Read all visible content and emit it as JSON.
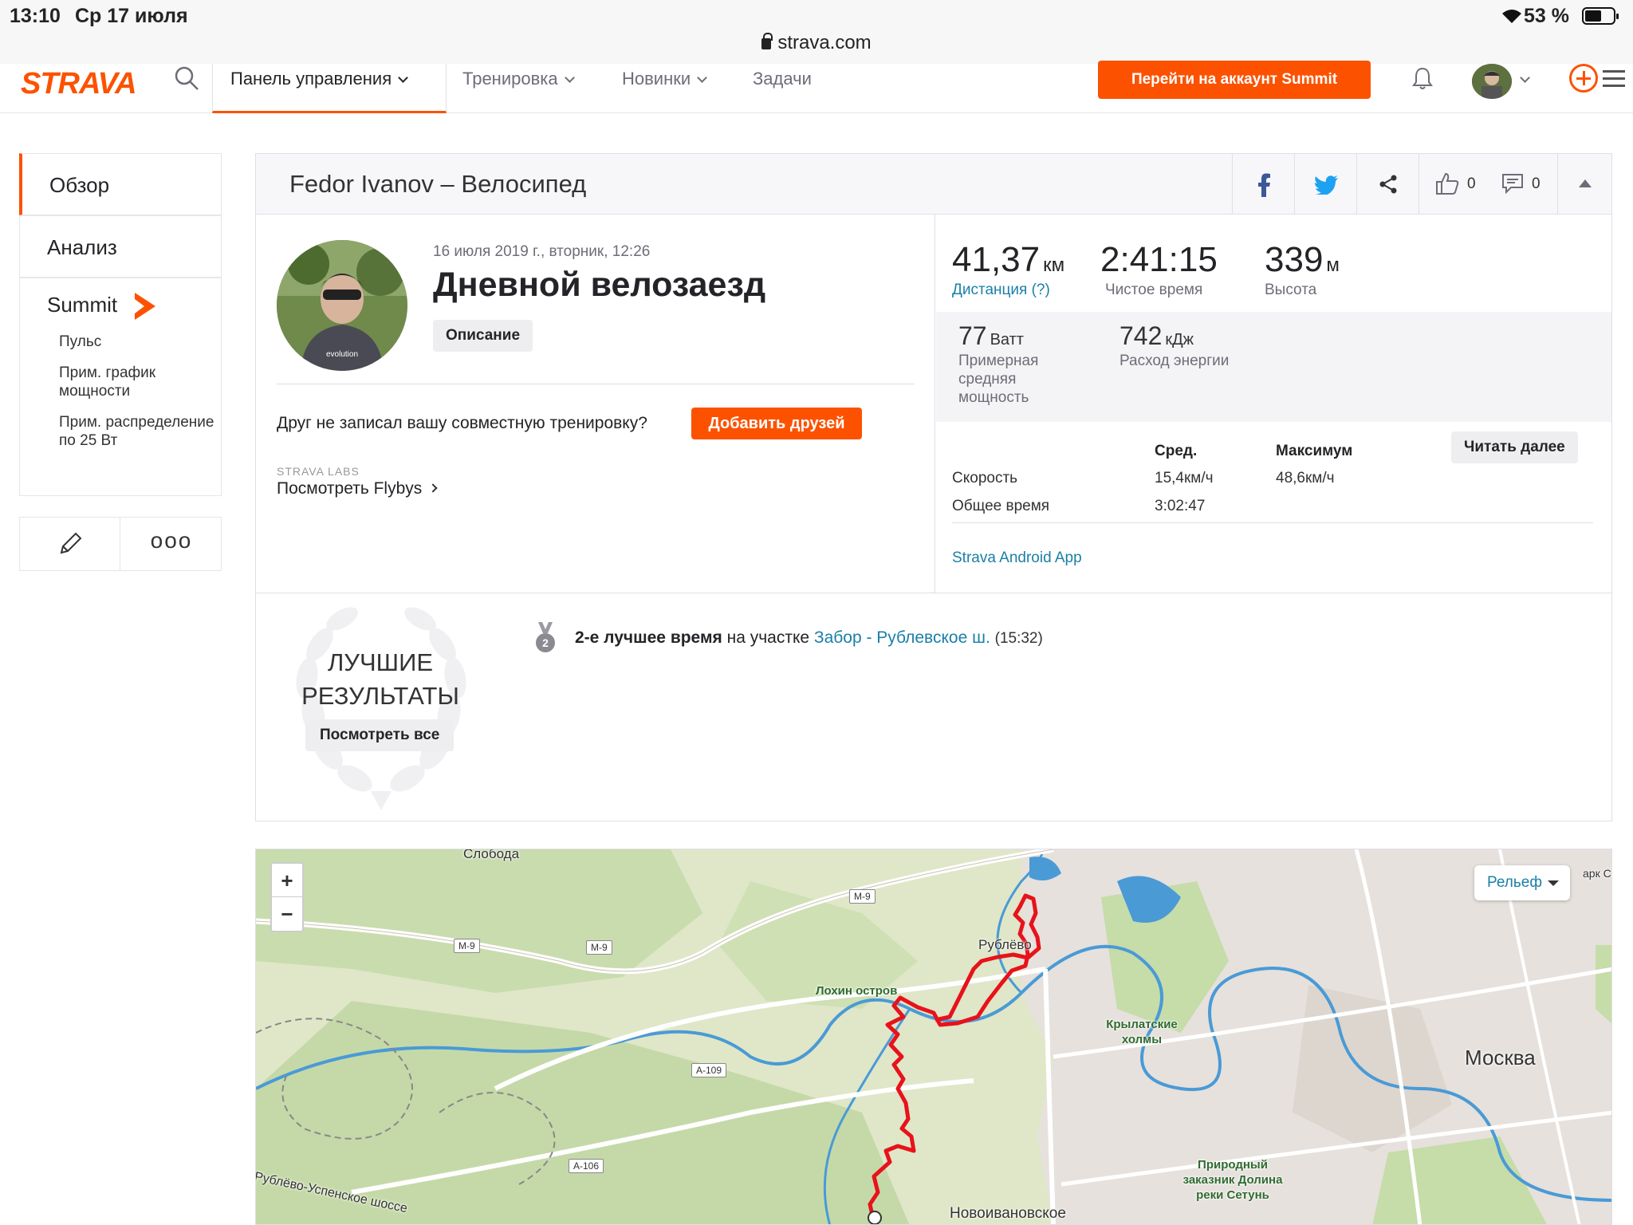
{
  "status_bar": {
    "time": "13:10",
    "date": "Ср 17 июля",
    "battery": "53 %",
    "url": "strava.com"
  },
  "nav": {
    "logo": "STRAVA",
    "tabs": [
      "Панель управления",
      "Тренировка",
      "Новинки",
      "Задачи"
    ],
    "summit_cta": "Перейти на аккаунт Summit"
  },
  "sidebar": {
    "items": [
      "Обзор",
      "Анализ",
      "Summit"
    ],
    "summit_links": [
      "Пульс",
      "Прим. график мощности",
      "Прим. распределение по 25 Вт"
    ],
    "more_label": "ooo"
  },
  "activity": {
    "owner_title": "Fedor Ivanov – Велосипед",
    "kudos_count": "0",
    "comments_count": "0",
    "date": "16 июля 2019 г., вторник, 12:26",
    "name": "Дневной велозаезд",
    "description_button": "Описание",
    "friend_prompt": "Друг не записал вашу совместную тренировку?",
    "add_friends": "Добавить друзей",
    "labs_label": "STRAVA LABS",
    "flybys_link": "Посмотреть Flybys"
  },
  "stats": {
    "distance": {
      "value": "41,37",
      "unit": "км",
      "label": "Дистанция (?)"
    },
    "moving_time": {
      "value": "2:41:15",
      "label": "Чистое время"
    },
    "elevation": {
      "value": "339",
      "unit": "м",
      "label": "Высота"
    },
    "power": {
      "value": "77",
      "unit": "Ватт",
      "label": "Примерная средняя мощность"
    },
    "energy": {
      "value": "742",
      "unit": "кДж",
      "label": "Расход энергии"
    },
    "table_headers": [
      "Сред.",
      "Максимум"
    ],
    "rows": [
      {
        "label": "Скорость",
        "avg": "15,4км/ч",
        "max": "48,6км/ч"
      },
      {
        "label": "Общее время",
        "avg": "3:02:47",
        "max": ""
      }
    ],
    "read_more": "Читать далее",
    "device": "Strava Android App"
  },
  "achievements": {
    "title_line1": "ЛУЧШИЕ",
    "title_line2": "РЕЗУЛЬТАТЫ",
    "view_all": "Посмотреть все",
    "medal_rank": "2",
    "rank_text": "2-е лучшее время",
    "on_segment": "на участке",
    "segment_name": "Забор - Рублевское ш.",
    "segment_time": "(15:32)"
  },
  "map": {
    "zoom_in": "+",
    "zoom_out": "−",
    "terrain_option": "Рельеф",
    "labels": {
      "sloboda": "Слобода",
      "rublevo": "Рублёво",
      "lokhin": "Лохин остров",
      "krylatskie": "Крылатские холмы",
      "moskva": "Москва",
      "park": "арк С",
      "prirodny": "Природный заказник Долина реки Сетунь",
      "novoivanovskoe": "Новоивановское",
      "usp_shosse": "Рублёво-Успенское шоссе"
    },
    "roads": [
      "М-9",
      "М-9",
      "М-9",
      "А-109",
      "А-106"
    ]
  },
  "colors": {
    "accent": "#fc5200",
    "link": "#1b7fa7",
    "route": "#e8121b",
    "river": "#4a9ad6"
  }
}
